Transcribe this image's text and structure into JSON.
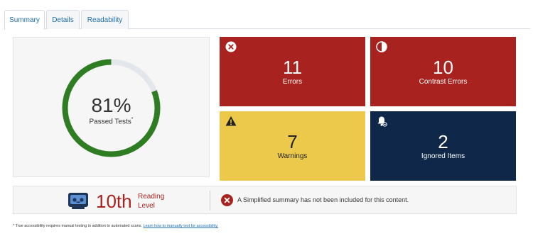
{
  "tabs": [
    {
      "label": "Summary",
      "active": true
    },
    {
      "label": "Details",
      "active": false
    },
    {
      "label": "Readability",
      "active": false
    }
  ],
  "gauge": {
    "percent_text": "81%",
    "percent_value": 81,
    "label": "Passed Tests",
    "label_mark": "*",
    "track_color": "#e3e6ea",
    "fill_color": "#2e7d22"
  },
  "tiles": {
    "errors": {
      "count": "11",
      "label": "Errors",
      "icon": "x-circle-icon",
      "color": "#a8231f"
    },
    "contrast": {
      "count": "10",
      "label": "Contrast Errors",
      "icon": "contrast-icon",
      "color": "#a8231f"
    },
    "warnings": {
      "count": "7",
      "label": "Warnings",
      "icon": "warning-triangle-icon",
      "color": "#ecc94b"
    },
    "ignored": {
      "count": "2",
      "label": "Ignored Items",
      "icon": "bell-off-icon",
      "color": "#0f2749"
    }
  },
  "readability": {
    "grade": "10th",
    "label_line1": "Reading",
    "label_line2": "Level",
    "icon": "robot-icon"
  },
  "summary_message": "A Simplified summary has not been included for this content.",
  "footnote": {
    "text": "* True accessibility requires manual testing in addition to automated scans.",
    "link": "Learn how to manually test for accessibility."
  }
}
